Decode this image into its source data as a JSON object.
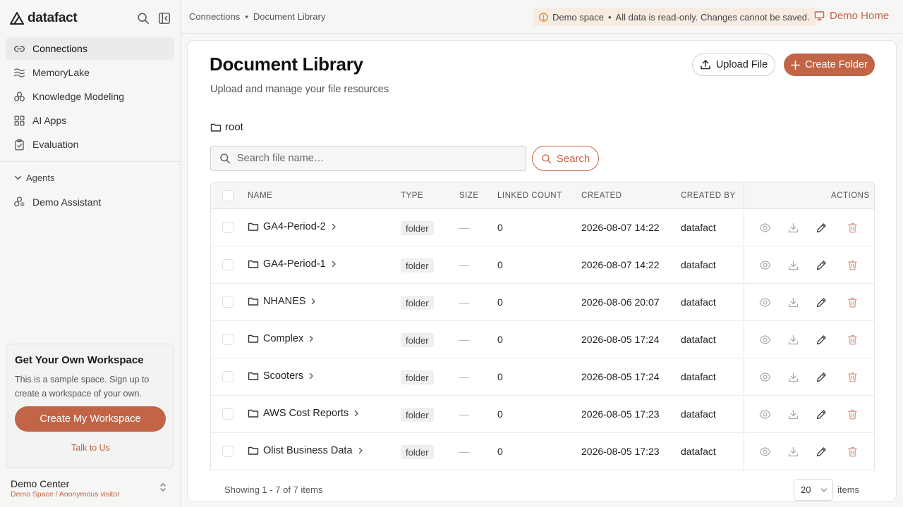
{
  "brand": {
    "name": "datafact"
  },
  "sidebar": {
    "items": [
      {
        "label": "Connections",
        "icon": "link-icon",
        "active": true
      },
      {
        "label": "MemoryLake",
        "icon": "waves-icon",
        "active": false
      },
      {
        "label": "Knowledge Modeling",
        "icon": "cubes-icon",
        "active": false
      },
      {
        "label": "AI Apps",
        "icon": "grid-icon",
        "active": false
      },
      {
        "label": "Evaluation",
        "icon": "clipboard-icon",
        "active": false
      }
    ],
    "agents_label": "Agents",
    "agents": [
      {
        "label": "Demo Assistant",
        "icon": "bot-icon"
      }
    ],
    "promo": {
      "title": "Get Your Own Workspace",
      "text": "This is a sample space. Sign up to create a workspace of your own.",
      "button": "Create My Workspace",
      "link": "Talk to Us"
    },
    "account": {
      "name": "Demo Center",
      "sub": "Demo Space / Anonymous visitor"
    }
  },
  "topbar": {
    "breadcrumb": [
      "Connections",
      "Document Library"
    ],
    "breadcrumb_sep": "•",
    "notice": {
      "label": "Demo space",
      "sep": "•",
      "text": "All data is read-only. Changes cannot be saved."
    },
    "home_link": "Demo Home"
  },
  "main": {
    "title": "Document Library",
    "subtitle": "Upload and manage your file resources",
    "upload_label": "Upload File",
    "create_label": "Create Folder",
    "path": "root",
    "search": {
      "placeholder": "Search file name…",
      "button": "Search"
    },
    "columns": [
      "Name",
      "Type",
      "Size",
      "Linked Count",
      "Created",
      "Created By",
      "Actions"
    ],
    "rows": [
      {
        "name": "GA4-Period-2",
        "type": "folder",
        "size": "—",
        "linked": "0",
        "created": "2026-08-07 14:22",
        "by": "datafact"
      },
      {
        "name": "GA4-Period-1",
        "type": "folder",
        "size": "—",
        "linked": "0",
        "created": "2026-08-07 14:22",
        "by": "datafact"
      },
      {
        "name": "NHANES",
        "type": "folder",
        "size": "—",
        "linked": "0",
        "created": "2026-08-06 20:07",
        "by": "datafact"
      },
      {
        "name": "Complex",
        "type": "folder",
        "size": "—",
        "linked": "0",
        "created": "2026-08-05 17:24",
        "by": "datafact"
      },
      {
        "name": "Scooters",
        "type": "folder",
        "size": "—",
        "linked": "0",
        "created": "2026-08-05 17:24",
        "by": "datafact"
      },
      {
        "name": "AWS Cost Reports",
        "type": "folder",
        "size": "—",
        "linked": "0",
        "created": "2026-08-05 17:23",
        "by": "datafact"
      },
      {
        "name": "Olist Business Data",
        "type": "folder",
        "size": "—",
        "linked": "0",
        "created": "2026-08-05 17:23",
        "by": "datafact"
      }
    ],
    "pagination": {
      "info": "Showing 1 - 7 of 7 items",
      "page_size": "20",
      "items_label": "items"
    }
  },
  "colors": {
    "accent": "#c26446",
    "notice_bg": "#f6ece2",
    "delete": "#e49a8a"
  }
}
